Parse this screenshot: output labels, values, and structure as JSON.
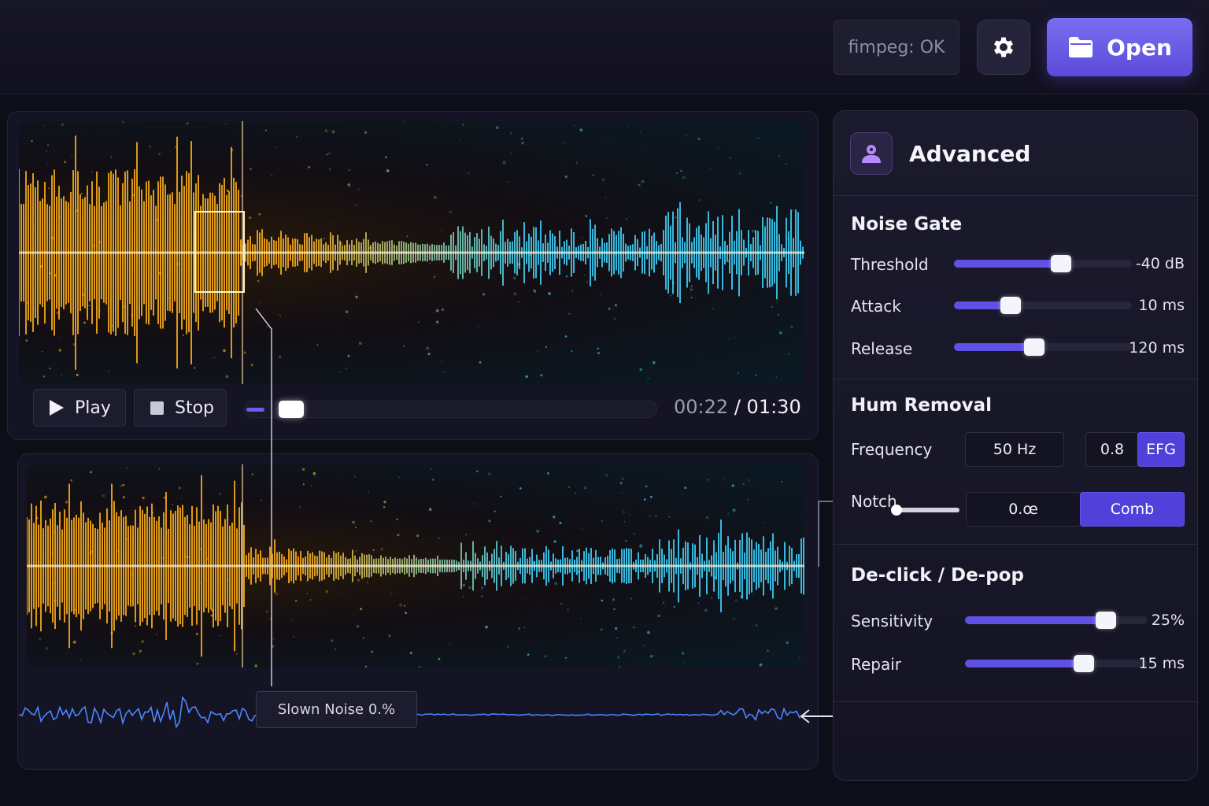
{
  "topbar": {
    "status": "fimpeg: OK",
    "settings_icon": "gear-icon",
    "open_icon": "folder-icon",
    "open_label": "Open"
  },
  "player": {
    "play_label": "Play",
    "stop_label": "Stop",
    "current_time": "00:22",
    "separator": "/",
    "duration": "01:30",
    "progress": 0.244
  },
  "tooltip": {
    "text": "Slown Noise 0.%"
  },
  "panel": {
    "title": "Advanced",
    "icon": "user-shield-icon",
    "noise_gate": {
      "title": "Noise Gate",
      "threshold": {
        "label": "Threshold",
        "value": "-40 dB",
        "level": 0.6
      },
      "attack": {
        "label": "Attack",
        "value": "10 ms",
        "level": 0.32
      },
      "release": {
        "label": "Release",
        "value": "120 ms",
        "level": 0.45
      }
    },
    "hum_removal": {
      "title": "Hum Removal",
      "frequency": {
        "label": "Frequency",
        "value": "50 Hz",
        "q_value": "0.8",
        "button": "EFG"
      },
      "notch": {
        "label": "Notch",
        "value": "0.œ",
        "button": "Comb"
      }
    },
    "declick": {
      "title": "De-click / De-pop",
      "sensitivity": {
        "label": "Sensitivity",
        "value": "25%",
        "level": 0.77
      },
      "repair": {
        "label": "Repair",
        "value": "15 ms",
        "level": 0.65
      }
    }
  },
  "colors": {
    "accent": "#5f50e6",
    "wave_warm": "#ffb21a",
    "wave_cool": "#3fd6ff"
  }
}
